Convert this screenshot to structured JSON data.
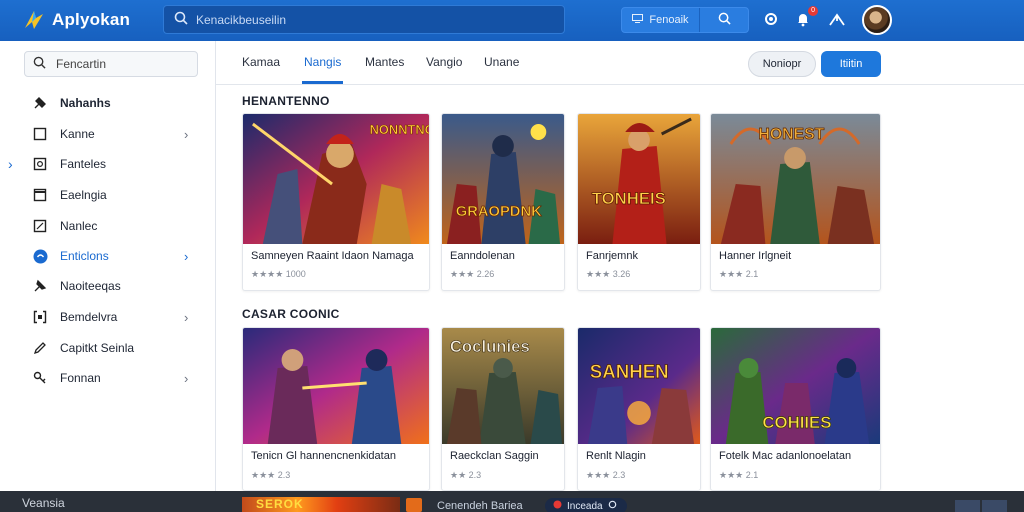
{
  "app": {
    "title": "Aplyokan"
  },
  "header": {
    "search_placeholder": "Kenacikbeuseilin",
    "search_button": "Fenoaik",
    "notif_badge": "0"
  },
  "sidebar": {
    "search_placeholder": "Fencartin",
    "items": [
      {
        "label": "Nahanhs",
        "icon": "tools-icon"
      },
      {
        "label": "Kanne",
        "icon": "square-icon"
      },
      {
        "label": "Fanteles",
        "icon": "image-icon"
      },
      {
        "label": "Eaelngia",
        "icon": "photo-icon"
      },
      {
        "label": "Nanlec",
        "icon": "crop-icon"
      },
      {
        "label": "Enticlons",
        "icon": "circle-icon"
      },
      {
        "label": "Naoiteeqas",
        "icon": "pin-icon"
      },
      {
        "label": "Bemdelvra",
        "icon": "bracket-icon"
      },
      {
        "label": "Capitkt Seinla",
        "icon": "pencil-icon"
      },
      {
        "label": "Fonnan",
        "icon": "key-icon"
      }
    ]
  },
  "tabs": [
    "Kamaa",
    "Nangis",
    "Mantes",
    "Vangio",
    "Unane"
  ],
  "actions": {
    "secondary": "Noniopr",
    "primary": "Itiitin"
  },
  "sections": [
    {
      "title": "HENANTENNO",
      "cards": [
        {
          "caption": "Samneyen Raaint Idaon Namaga",
          "sub": "★★★★ 1000"
        },
        {
          "caption": "Eanndolenan",
          "sub": "★★★ 2.26"
        },
        {
          "caption": "Fanrjemnk",
          "sub": "★★★ 3.26"
        },
        {
          "caption": "Hanner Irlgneit",
          "sub": "★★★ 2.1"
        }
      ]
    },
    {
      "title": "CASAR COONIC",
      "cards": [
        {
          "caption": "Tenicn Gl hannencnenkidatan",
          "sub": "★★★ 2.3"
        },
        {
          "caption": "Raeckclan Saggin",
          "sub": "★★ 2.3"
        },
        {
          "caption": "Renlt Nlagin",
          "sub": "★★★ 2.3"
        },
        {
          "caption": "Fotelk Mac adanlonoelatan",
          "sub": "★★★ 2.1"
        }
      ]
    }
  ],
  "thumb_texts": [
    "NONNTNG",
    "GRAOPDNK",
    "TONHEIS",
    "HONEST",
    "",
    "Coclunies",
    "SANHEN",
    "COHIIES"
  ],
  "bottom": {
    "title": "Veansia",
    "thumb_text": "SEROK",
    "text": "Cenendeh Bariea",
    "pill": "Inceada"
  },
  "colors": {
    "accent": "#1a6ad0",
    "topbar": "#1760bf"
  }
}
